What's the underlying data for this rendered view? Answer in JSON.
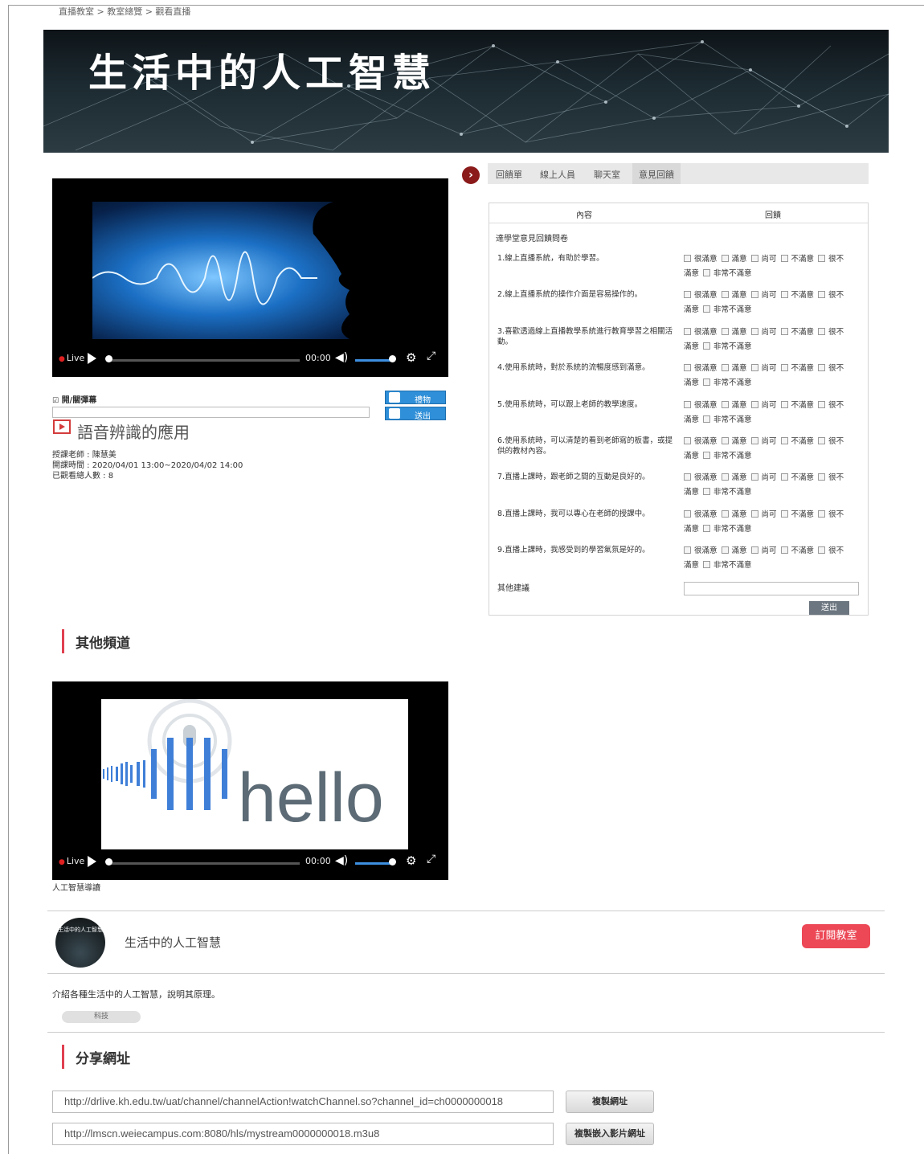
{
  "breadcrumb": "直播教室 > 教室總覽 > 觀看直播",
  "banner": {
    "title": "生活中的人工智慧"
  },
  "player_main": {
    "live_label": "Live",
    "time": "00:00"
  },
  "danmaku": {
    "toggle_label": "開/關彈幕",
    "checked": true
  },
  "actions": {
    "gift_label": "禮物",
    "send_label": "送出"
  },
  "course": {
    "title": "語音辨識的應用",
    "teacher": "授課老師 : 陳慧美",
    "time": "開課時間 : 2020/04/01 13:00~2020/04/02 14:00",
    "viewers": "已觀看總人數 : 8"
  },
  "tabs": [
    "回饋單",
    "線上人員",
    "聊天室",
    "意見回饋"
  ],
  "active_tab": "意見回饋",
  "survey": {
    "header_content": "內容",
    "header_feedback": "回饋",
    "title": "達學堂意見回饋問卷",
    "questions": [
      "1.線上直播系統，有助於學習。",
      "2.線上直播系統的操作介面是容易操作的。",
      "3.喜歡透過線上直播教學系統進行教育學習之相關活動。",
      "4.使用系統時，對於系統的流暢度感到滿意。",
      "5.使用系統時，可以跟上老師的教學速度。",
      "6.使用系統時，可以清楚的看到老師寫的板書，或提供的教材內容。",
      "7.直播上課時，跟老師之間的互動是良好的。",
      "8.直播上課時，我可以專心在老師的授課中。",
      "9.直播上課時，我感受到的學習氣氛是好的。"
    ],
    "options_line1": [
      "很滿意",
      "滿意",
      "尚可",
      "不滿意"
    ],
    "option_split_a": "很不",
    "option_split_b": "滿意",
    "option_last": "非常不滿意",
    "other_label": "其他建議",
    "submit_label": "送出"
  },
  "other_channels": {
    "heading": "其他頻道",
    "player": {
      "live_label": "Live",
      "time": "00:00",
      "thumbnail_text": "hello"
    },
    "caption": "人工智慧導讀"
  },
  "channel": {
    "avatar_text": "生活中的人工智慧",
    "name": "生活中的人工智慧",
    "subscribe_label": "訂閱教室",
    "description": "介紹各種生活中的人工智慧，說明其原理。",
    "tag": "科技"
  },
  "share": {
    "heading": "分享網址",
    "url1": "http://drlive.kh.edu.tw/uat/channel/channelAction!watchChannel.so?channel_id=ch0000000018",
    "url2": "http://lmscn.weiecampus.com:8080/hls/mystream0000000018.m3u8",
    "copy_url_label": "複製網址",
    "copy_embed_label": "複製嵌入影片網址"
  },
  "colors": {
    "accent_red": "#ec4856",
    "button_blue": "#2f8fd8",
    "dark_red": "#8b1a1a"
  }
}
